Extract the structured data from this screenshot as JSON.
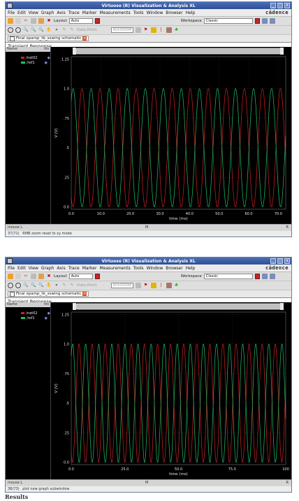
{
  "windows": [
    {
      "title": "Virtuoso (R) Visualization & Analysis XL",
      "menus": [
        "File",
        "Edit",
        "View",
        "Graph",
        "Axis",
        "Trace",
        "Marker",
        "Measurements",
        "Tools",
        "Window",
        "Browser",
        "Help"
      ],
      "brand": "cādence",
      "toolbar": {
        "layout_label": "Layout",
        "layout_value": "Auto",
        "workspace_label": "Workspace",
        "workspace_value": "Classic",
        "data_point_label": "Data Point",
        "data_point_value": "4010000M"
      },
      "tab_label": "Final opamp_tb_sswing schematic",
      "panel_title": "Transient Response",
      "legend_header": {
        "name": "Name",
        "vis": "Vis"
      },
      "traces": [
        {
          "name": "/net02",
          "color": "#d42020"
        },
        {
          "name": "/ref1",
          "color": "#22c06a"
        }
      ],
      "chart_data": {
        "type": "line",
        "xlabel": "time (ms)",
        "ylabel": "V (V)",
        "xlim": [
          0,
          72.5
        ],
        "ylim": [
          -0.02,
          1.27
        ],
        "x_ticks": [
          0.0,
          10.0,
          20.0,
          30.0,
          40.0,
          50.0,
          60.0,
          70.0
        ],
        "x_tick_labels": [
          "0.0",
          "10.0",
          "20.0",
          "30.0",
          "40.0",
          "50.0",
          "60.0",
          "70.0"
        ],
        "y_ticks": [
          0.0,
          0.25,
          0.5,
          0.75,
          1.0,
          1.25
        ],
        "y_tick_labels": [
          "0.0",
          ".25",
          ".5",
          ".75",
          "1.0",
          "1.25"
        ],
        "series": [
          {
            "name": "/net02",
            "amplitude": 0.5,
            "offset": 0.5,
            "period_ms": 6.1,
            "phase_ms": 2.1
          },
          {
            "name": "/ref1",
            "amplitude": 0.5,
            "offset": 0.5,
            "period_ms": 6.1,
            "phase_ms": -0.9
          }
        ],
        "grid": true
      },
      "status": {
        "left": "mouse L",
        "middle": "M",
        "right": "R",
        "message_num": "37(71)",
        "message": "RMB zoom reset to xy mode"
      }
    },
    {
      "title": "Virtuoso (R) Visualization & Analysis XL",
      "menus": [
        "File",
        "Edit",
        "View",
        "Graph",
        "Axis",
        "Trace",
        "Marker",
        "Measurements",
        "Tools",
        "Window",
        "Browser",
        "Help"
      ],
      "brand": "cādence",
      "toolbar": {
        "layout_label": "Layout",
        "layout_value": "Auto",
        "workspace_label": "Workspace",
        "workspace_value": "Classic",
        "data_point_label": "Data Point",
        "data_point_value": "4010000M"
      },
      "tab_label": "Final opamp_tb_sswing schematic",
      "panel_title": "Transient Response",
      "legend_header": {
        "name": "Name",
        "vis": "Vis"
      },
      "traces": [
        {
          "name": "/net02",
          "color": "#d42020"
        },
        {
          "name": "/ref1",
          "color": "#22c06a"
        }
      ],
      "chart_data": {
        "type": "line",
        "xlabel": "time (ms)",
        "ylabel": "V (V)",
        "xlim": [
          0,
          100
        ],
        "ylim": [
          -0.02,
          1.27
        ],
        "x_ticks": [
          0.0,
          25.0,
          50.0,
          75.0,
          100.0
        ],
        "x_tick_labels": [
          "0.0",
          "25.0",
          "50.0",
          "75.0",
          "100"
        ],
        "y_ticks": [
          0.0,
          0.25,
          0.5,
          0.75,
          1.0,
          1.25
        ],
        "y_tick_labels": [
          "0.0",
          ".25",
          ".5",
          ".75",
          "1.0",
          "1.25"
        ],
        "series": [
          {
            "name": "/net02",
            "amplitude": 0.5,
            "offset": 0.5,
            "period_ms": 6.1,
            "phase_ms": 2.1
          },
          {
            "name": "/ref1",
            "amplitude": 0.5,
            "offset": 0.5,
            "period_ms": 6.1,
            "phase_ms": -0.9
          }
        ],
        "grid": true
      },
      "status": {
        "left": "mouse L",
        "middle": "M",
        "right": "R",
        "message_num": "38(73)",
        "message": "plot new graph subwindow"
      }
    }
  ],
  "footer_caption": "Results"
}
